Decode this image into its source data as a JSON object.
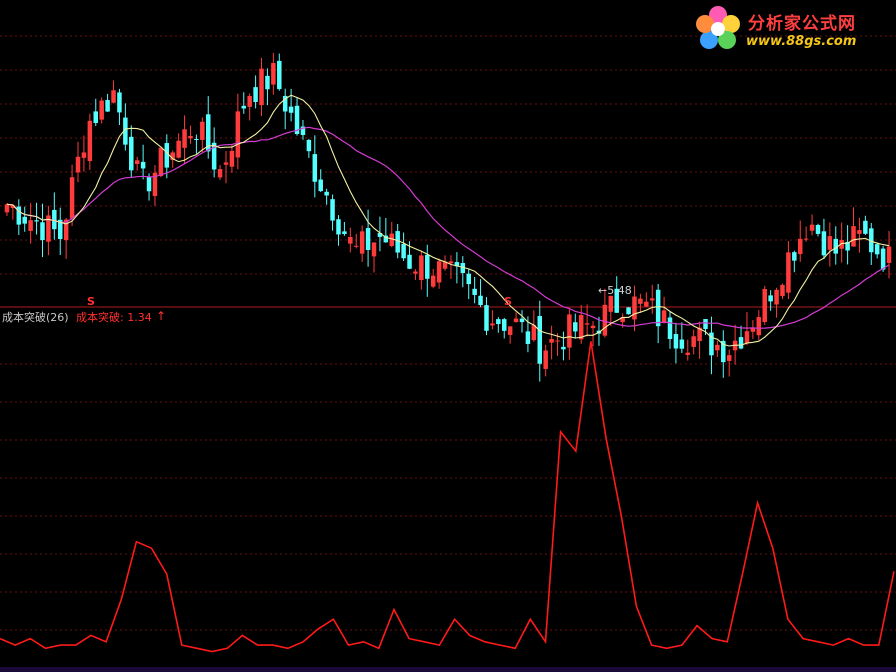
{
  "indicator": {
    "title": "成本突破(26)",
    "value_label": "成本突破: 1.34",
    "arrow": "↑"
  },
  "price_panel": {
    "low_label": "←5.48",
    "signals": [
      "S",
      "S"
    ]
  },
  "watermark": {
    "title": "分析家公式网",
    "url": "www.88gs.com",
    "logo_icon": "flower-logo-icon"
  },
  "colors": {
    "up": "#ff3b3b",
    "down": "#54ffff",
    "ma_short": "#f0f0a0",
    "ma_long": "#d23cd2",
    "indicator_line": "#ff1a1a",
    "grid": "#6e1010",
    "separator": "#aa1a1a"
  },
  "chart_data": [
    {
      "type": "candlestick",
      "series": [
        {
          "name": "",
          "values": [
            5.9,
            5.8,
            5.7,
            6.4,
            6.6,
            6.0,
            6.2,
            6.4,
            6.1,
            6.6,
            6.7,
            6.3,
            5.95,
            5.6,
            5.7,
            5.55,
            5.5,
            5.4,
            5.2,
            5.15,
            5.0,
            5.1,
            5.15,
            5.3,
            5.25,
            5.1,
            5.05,
            5.0,
            5.2,
            5.5,
            5.8,
            5.6,
            5.7,
            5.55
          ]
        },
        {
          "name": "",
          "values": []
        },
        {
          "name": "",
          "values": []
        }
      ]
    },
    {
      "type": "line",
      "title": "成本突破(26)",
      "series": [
        {
          "name": "成本突破",
          "values": [
            0.3,
            0.2,
            0.3,
            0.15,
            0.2,
            0.2,
            0.35,
            0.25,
            0.9,
            1.8,
            1.7,
            1.3,
            0.2,
            0.15,
            0.1,
            0.15,
            0.35,
            0.2,
            0.2,
            0.15,
            0.25,
            0.45,
            0.6,
            0.2,
            0.25,
            0.15,
            0.75,
            0.3,
            0.25,
            0.2,
            0.6,
            0.35,
            0.25,
            0.2,
            0.15,
            0.6,
            0.25,
            3.5,
            3.2,
            4.9,
            3.4,
            2.2,
            0.8,
            0.2,
            0.15,
            0.2,
            0.5,
            0.3,
            0.25,
            1.3,
            2.4,
            1.7,
            0.6,
            0.3,
            0.25,
            0.2,
            0.3,
            0.2,
            0.2,
            1.34
          ]
        }
      ]
    }
  ]
}
